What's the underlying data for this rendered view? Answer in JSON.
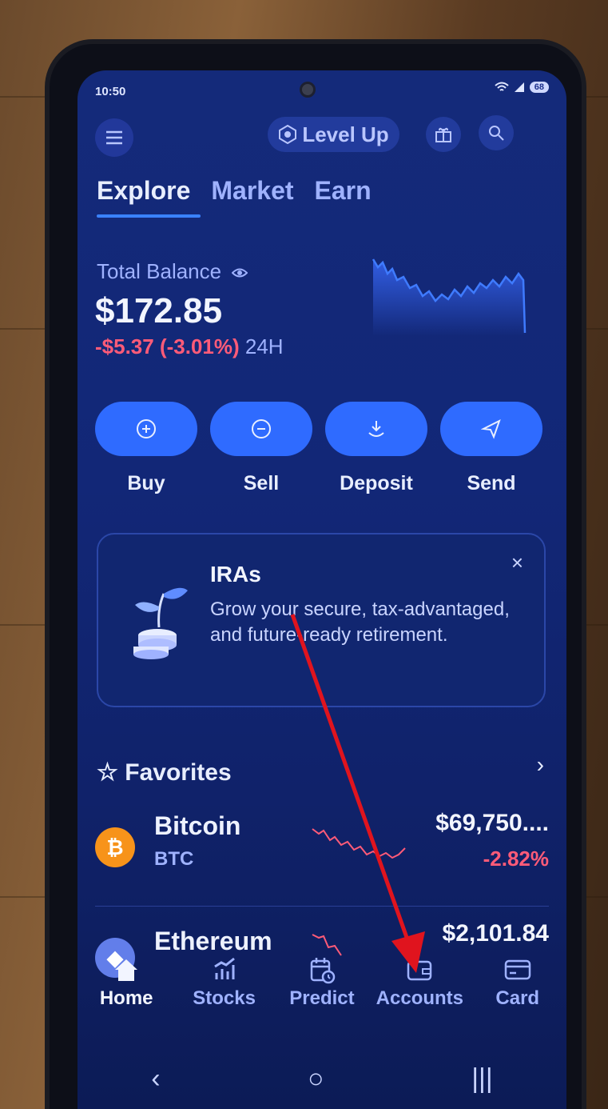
{
  "status_bar": {
    "time": "10:50",
    "battery": "68"
  },
  "header": {
    "level_up_label": "Level Up"
  },
  "tabs": [
    {
      "label": "Explore",
      "active": true
    },
    {
      "label": "Market",
      "active": false
    },
    {
      "label": "Earn",
      "active": false
    }
  ],
  "balance": {
    "label": "Total Balance",
    "value": "$172.85",
    "change": "-$5.37 (-3.01%)",
    "period": "24H"
  },
  "actions": [
    {
      "label": "Buy",
      "icon": "plus-circle-icon"
    },
    {
      "label": "Sell",
      "icon": "minus-circle-icon"
    },
    {
      "label": "Deposit",
      "icon": "download-icon"
    },
    {
      "label": "Send",
      "icon": "send-icon"
    }
  ],
  "promo": {
    "title": "IRAs",
    "text": "Grow your secure, tax-advantaged, and future-ready retirement.",
    "close": "×"
  },
  "favorites": {
    "title": "Favorites",
    "items": [
      {
        "name": "Bitcoin",
        "symbol": "BTC",
        "price": "$69,750....",
        "change": "-2.82%",
        "icon_color": "#f7931a",
        "icon_glyph": "₿"
      },
      {
        "name": "Ethereum",
        "symbol": "",
        "price": "$2,101.84",
        "change": "",
        "icon_color": "#627eea",
        "icon_glyph": "◆"
      }
    ]
  },
  "bottom_nav": [
    {
      "label": "Home",
      "icon": "home-icon",
      "active": true
    },
    {
      "label": "Stocks",
      "icon": "stocks-icon",
      "active": false
    },
    {
      "label": "Predict",
      "icon": "calendar-clock-icon",
      "active": false
    },
    {
      "label": "Accounts",
      "icon": "wallet-icon",
      "active": false
    },
    {
      "label": "Card",
      "icon": "card-icon",
      "active": false
    }
  ],
  "system_nav": {
    "back": "‹",
    "home": "○",
    "recents": "|||"
  },
  "colors": {
    "accent": "#2f6bff",
    "negative": "#ff5b78",
    "background": "#122777",
    "annotation_arrow": "#e0141e"
  }
}
